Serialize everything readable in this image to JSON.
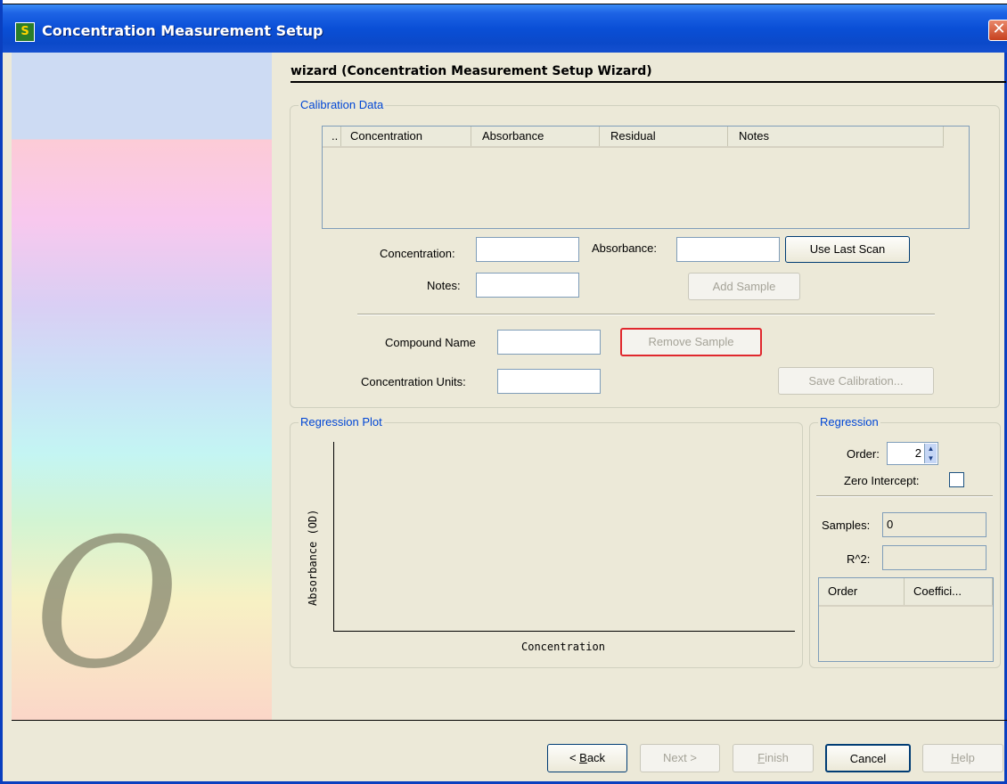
{
  "window": {
    "title": "Concentration Measurement Setup",
    "app_icon": "S",
    "close_icon": "✕"
  },
  "logo": {
    "glyph": "O"
  },
  "wizard": {
    "title": "wizard (Concentration Measurement Setup Wizard)"
  },
  "calibration": {
    "legend": "Calibration Data",
    "columns": [
      "..",
      "Concentration",
      "Absorbance",
      "Residual",
      "Notes"
    ],
    "concentration_label": "Concentration:",
    "concentration_value": "",
    "absorbance_label": "Absorbance:",
    "absorbance_value": "",
    "use_last_scan": "Use Last Scan",
    "notes_label": "Notes:",
    "notes_value": "",
    "add_sample": "Add Sample",
    "compound_name_label": "Compound Name",
    "compound_name_value": "",
    "remove_sample": "Remove Sample",
    "units_label": "Concentration Units:",
    "units_value": "",
    "save_calibration": "Save Calibration..."
  },
  "regression_plot": {
    "legend": "Regression Plot",
    "ylabel": "Absorbance (OD)",
    "xlabel": "Concentration"
  },
  "regression": {
    "legend": "Regression",
    "order_label": "Order:",
    "order_value": "2",
    "zero_intercept_label": "Zero Intercept:",
    "zero_intercept_checked": false,
    "samples_label": "Samples:",
    "samples_value": "0",
    "r2_label": "R^2:",
    "r2_value": "",
    "columns": [
      "Order",
      "Coeffici..."
    ]
  },
  "footer": {
    "back": "Back",
    "back_prefix": "< ",
    "back_mnemonic": "B",
    "back_rest": "ack",
    "next": "Next >",
    "finish_mnemonic": "F",
    "finish_rest": "inish",
    "cancel": "Cancel",
    "help_mnemonic": "H",
    "help_rest": "elp"
  }
}
